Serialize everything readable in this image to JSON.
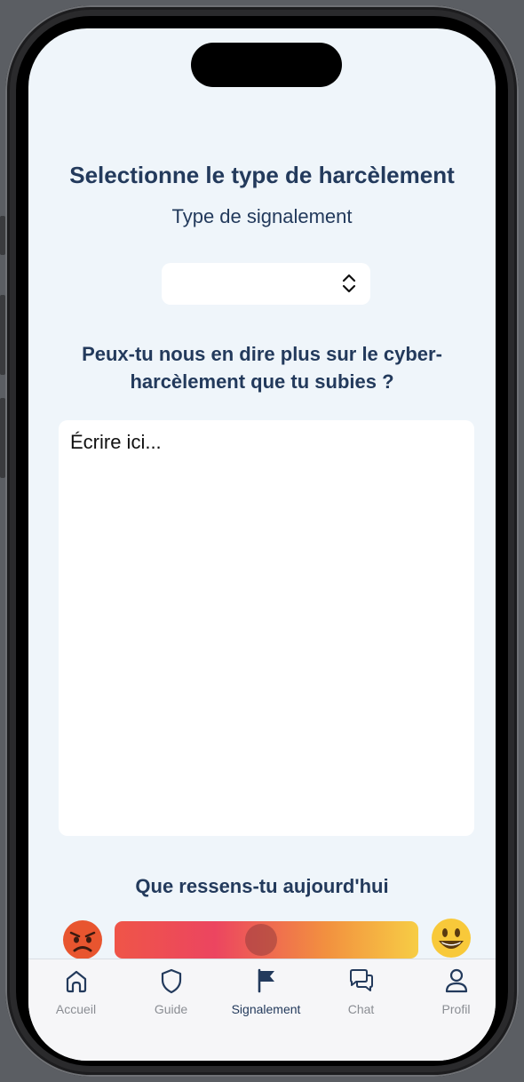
{
  "report": {
    "title": "Selectionne le type de harcèlement",
    "type_label": "Type de signalement",
    "picker_value": "",
    "question": "Peux-tu nous en dire plus sur le cyber-harcèlement que tu subies ?",
    "textarea_placeholder": "Écrire ici...",
    "feeling_label": "Que ressens-tu aujourd'hui",
    "feeling_value_percent": 48,
    "emoji_left": "😡",
    "emoji_right": "😃"
  },
  "tabbar": {
    "items": [
      {
        "label": "Accueil",
        "icon": "home-icon",
        "active": false
      },
      {
        "label": "Guide",
        "icon": "shield-icon",
        "active": false
      },
      {
        "label": "Signalement",
        "icon": "flag-icon",
        "active": true
      },
      {
        "label": "Chat",
        "icon": "chat-bubbles-icon",
        "active": false
      },
      {
        "label": "Profil",
        "icon": "person-icon",
        "active": false
      }
    ]
  },
  "colors": {
    "heading": "#233a5c",
    "background": "#eff5fa",
    "active_tab": "#233a5c",
    "inactive_tab": "#8a8d93"
  }
}
